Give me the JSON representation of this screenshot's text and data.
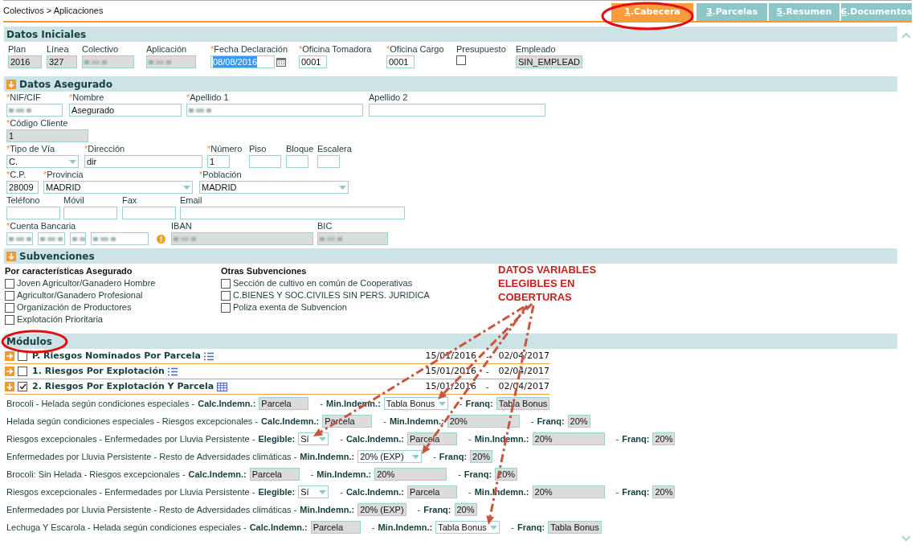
{
  "breadcrumb": "Colectivos > Aplicaciones",
  "tabs": [
    {
      "number": "1",
      "label": ".Cabecera",
      "selected": true
    },
    {
      "number": "3",
      "label": ".Parcelas",
      "selected": false
    },
    {
      "number": "5",
      "label": ".Resumen",
      "selected": false
    },
    {
      "number": "6",
      "label": ".Documentos",
      "selected": false
    }
  ],
  "datos_iniciales": {
    "title": "Datos Iniciales",
    "fields": [
      {
        "label": "Plan",
        "kind": "readonly",
        "value": "2016"
      },
      {
        "label": "Línea",
        "kind": "readonly",
        "value": "327"
      },
      {
        "label": "Colectivo",
        "kind": "readonly",
        "blurred": true
      },
      {
        "label": "Aplicación",
        "kind": "readonly",
        "blurred": true
      },
      {
        "asterisk": "*",
        "label": "Fecha Declaración",
        "kind": "date",
        "value": "08/08/2016",
        "selected": true
      },
      {
        "asterisk": "*",
        "label": "Oficina Tomadora",
        "kind": "input",
        "value": "0001"
      },
      {
        "asterisk": "*",
        "label": "Oficina Cargo",
        "kind": "input",
        "value": "0001"
      },
      {
        "label": "Presupuesto",
        "kind": "checkbox",
        "checked": false
      },
      {
        "label": "Empleado",
        "kind": "readonly",
        "value": "SIN_EMPLEAD"
      }
    ]
  },
  "datos_asegurado": {
    "title": "Datos Asegurado",
    "expanded": true,
    "lines": [
      {
        "fields": [
          {
            "asterisk": "*",
            "label": "NIF/CIF",
            "kind": "input",
            "blurred": true
          },
          {
            "asterisk": "*",
            "label": "Nombre",
            "kind": "input",
            "value": "Asegurado"
          },
          {
            "asterisk": "*",
            "label": "Apellido 1",
            "kind": "input",
            "blurred": true
          },
          {
            "label": "Apellido 2",
            "kind": "input"
          }
        ]
      },
      {
        "fields": [
          {
            "asterisk": "*",
            "label": "Código Cliente",
            "kind": "readonly",
            "value": "1"
          }
        ]
      },
      {
        "fields": [
          {
            "asterisk": "*",
            "label": "Tipo de Vía",
            "kind": "select",
            "value": "C."
          },
          {
            "asterisk": "*",
            "label": "Dirección",
            "kind": "input",
            "value": "dir"
          },
          {
            "asterisk": "*",
            "label": "Número",
            "kind": "input",
            "value": "1"
          },
          {
            "label": "Piso",
            "kind": "input"
          },
          {
            "label": "Bloque",
            "kind": "input"
          },
          {
            "label": "Escalera",
            "kind": "input"
          }
        ]
      },
      {
        "fields": [
          {
            "asterisk": "*",
            "label": "C.P.",
            "kind": "input",
            "value": "28009"
          },
          {
            "asterisk": "*",
            "label": "Provincia",
            "kind": "select",
            "value": "MADRID"
          },
          {
            "asterisk": "*",
            "label": "Población",
            "kind": "select",
            "value": "MADRID"
          }
        ]
      },
      {
        "fields": [
          {
            "label": "Teléfono",
            "kind": "input"
          },
          {
            "label": "Móvil",
            "kind": "input"
          },
          {
            "label": "Fax",
            "kind": "input"
          },
          {
            "label": "Email",
            "kind": "input"
          }
        ]
      },
      {
        "fields": [
          {
            "asterisk": "*",
            "label": "Cuenta Bancaria",
            "kind": "account",
            "parts": [
              {
                "blurred": true
              },
              {
                "blurred": true
              },
              {
                "blurred": true
              },
              {
                "blurred": true
              }
            ]
          },
          {
            "label": "IBAN",
            "kind": "readonly",
            "blurred": true
          },
          {
            "label": "BIC",
            "kind": "readonly",
            "blurred": true
          }
        ]
      }
    ]
  },
  "subvenciones": {
    "title": "Subvenciones",
    "expanded": true,
    "columns": [
      {
        "heading": "Por características Asegurado",
        "items": [
          {
            "label": "Joven Agricultor/Ganadero Hombre",
            "checked": false
          },
          {
            "label": "Agricultor/Ganadero Profesional",
            "checked": false
          },
          {
            "label": "Organización de Productores",
            "checked": false
          },
          {
            "label": "Explotación Prioritaria",
            "checked": false
          }
        ]
      },
      {
        "heading": "Otras Subvenciones",
        "items": [
          {
            "label": "Sección de cultivo en común de Cooperativas",
            "checked": false
          },
          {
            "label": "C.BIENES Y SOC.CIVILES SIN PERS. JURIDICA",
            "checked": false
          },
          {
            "label": "Poliza exenta de Subvencion",
            "checked": false
          }
        ]
      }
    ]
  },
  "modulos": {
    "title": "Módulos",
    "items": [
      {
        "name": "P. Riesgos Nominados Por Parcela",
        "checked": false,
        "expanded": false,
        "kind": "list",
        "start": "15/01/2016",
        "separator": "-",
        "end": "02/04/2017"
      },
      {
        "name": "1. Riesgos Por Explotación",
        "checked": false,
        "expanded": false,
        "kind": "list",
        "start": "15/01/2016",
        "separator": "-",
        "end": "02/04/2017"
      },
      {
        "name": "2. Riesgos Por Explotación Y Parcela",
        "checked": true,
        "expanded": true,
        "kind": "table",
        "start": "15/01/2016",
        "separator": "-",
        "end": "02/04/2017"
      }
    ],
    "coverages": [
      {
        "text": "Brocoli - Helada según condiciones especiales -",
        "fields": [
          {
            "label": "Calc.Indemn.:",
            "kind": "readonly",
            "value": "Parcela"
          },
          {
            "prefix": "-",
            "label": "Min.Indemn.:",
            "kind": "select",
            "value": "Tabla Bonus"
          },
          {
            "prefix": "-",
            "label": "Franq:",
            "kind": "readonly",
            "value": "Tabla Bonus"
          }
        ]
      },
      {
        "text": "Helada según condiciones especiales - Riesgos excepcionales -",
        "fields": [
          {
            "label": "Calc.Indemn.:",
            "kind": "readonly",
            "value": "Parcela"
          },
          {
            "prefix": "-",
            "label": "Min.Indemn.:",
            "kind": "readonly",
            "value": "20%"
          },
          {
            "prefix": "-",
            "label": "Franq:",
            "kind": "readonly",
            "value": "20%"
          }
        ]
      },
      {
        "text": "Riesgos excepcionales - Enfermedades por Lluvia Persistente -",
        "fields": [
          {
            "label": "Elegible:",
            "kind": "select",
            "value": "Sí"
          },
          {
            "prefix": "-",
            "label": "Calc.Indemn.:",
            "kind": "readonly",
            "value": "Parcela"
          },
          {
            "prefix": "-",
            "label": "Min.Indemn.:",
            "kind": "readonly",
            "value": "20%"
          },
          {
            "prefix": "-",
            "label": "Franq:",
            "kind": "readonly",
            "value": "20%"
          }
        ]
      },
      {
        "text": "Enfermedades por Lluvia Persistente - Resto de Adversidades climáticas -",
        "fields": [
          {
            "label": "Min.Indemn.:",
            "kind": "select",
            "value": "20% (EXP)"
          },
          {
            "prefix": "-",
            "label": "Franq:",
            "kind": "readonly",
            "value": "20%"
          }
        ]
      },
      {
        "text": "Brocoli: Sin Helada - Riesgos excepcionales -",
        "fields": [
          {
            "label": "Calc.Indemn.:",
            "kind": "readonly",
            "value": "Parcela"
          },
          {
            "prefix": "-",
            "label": "Min.Indemn.:",
            "kind": "readonly",
            "value": "20%"
          },
          {
            "prefix": "-",
            "label": "Franq:",
            "kind": "readonly",
            "value": "20%"
          }
        ]
      },
      {
        "text": "Riesgos excepcionales - Enfermedades por Lluvia Persistente -",
        "fields": [
          {
            "label": "Elegible:",
            "kind": "select",
            "value": "Sí"
          },
          {
            "prefix": "-",
            "label": "Calc.Indemn.:",
            "kind": "readonly",
            "value": "Parcela"
          },
          {
            "prefix": "-",
            "label": "Min.Indemn.:",
            "kind": "readonly",
            "value": "20%"
          },
          {
            "prefix": "-",
            "label": "Franq:",
            "kind": "readonly",
            "value": "20%"
          }
        ]
      },
      {
        "text": "Enfermedades por Lluvia Persistente - Resto de Adversidades climáticas -",
        "fields": [
          {
            "label": "Min.Indemn.:",
            "kind": "readonly",
            "value": "20% (EXP)"
          },
          {
            "prefix": "-",
            "label": "Franq:",
            "kind": "readonly",
            "value": "20%"
          }
        ]
      },
      {
        "text": "Lechuga Y Escarola - Helada según condiciones especiales -",
        "fields": [
          {
            "label": "Calc.Indemn.:",
            "kind": "readonly",
            "value": "Parcela"
          },
          {
            "prefix": "-",
            "label": "Min.Indemn.:",
            "kind": "select",
            "value": "Tabla Bonus"
          },
          {
            "prefix": "-",
            "label": "Franq:",
            "kind": "readonly",
            "value": "Tabla Bonus"
          }
        ]
      }
    ]
  },
  "annotation": {
    "lines": [
      "DATOS VARIABLES",
      "ELEGIBLES EN",
      "COBERTURAS"
    ]
  }
}
